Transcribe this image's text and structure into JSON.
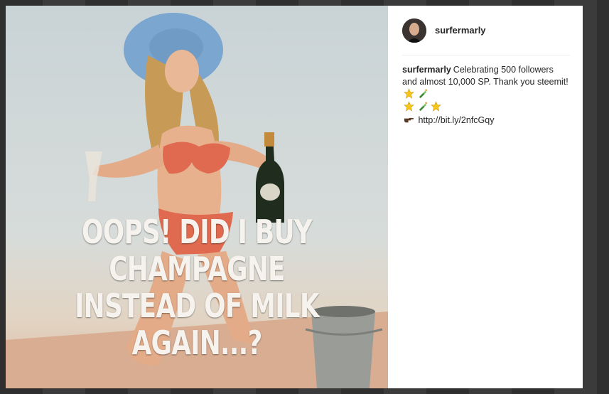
{
  "post": {
    "username": "surfermarly",
    "caption_user": "surfermarly",
    "caption_line1": "Celebrating 500 followers and almost 10,000 SP. Thank you steemit!",
    "link": "http://bit.ly/2nfcGqy"
  },
  "image": {
    "meme_lines": [
      "OOPS! DID I BUY",
      "CHAMPAGNE",
      "INSTEAD OF MILK",
      "AGAIN...?"
    ]
  },
  "icons": {
    "star": "star-emoji",
    "bottle": "champagne-bottle-emoji",
    "pointer": "pointing-hand-emoji"
  }
}
